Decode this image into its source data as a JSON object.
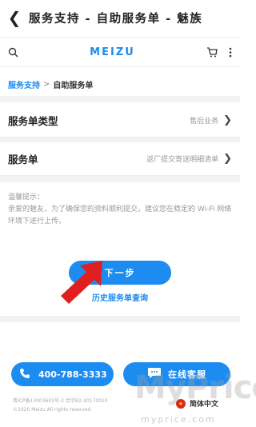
{
  "titlebar": {
    "title": "服务支持 - 自助服务单 - 魅族"
  },
  "navbar": {
    "logo": "MEIZU"
  },
  "breadcrumb": {
    "parent": "服务支持",
    "separator": ">",
    "current": "自助服务单"
  },
  "form": {
    "rows": [
      {
        "label": "服务单类型",
        "value": "售后业务"
      },
      {
        "label": "服务单",
        "value": "返厂提交寄送明细清单"
      }
    ]
  },
  "notice": {
    "line1": "温馨提示：",
    "line2": "亲爱的魅友，为了确保您的资料顺利提交，建议您在稳定的 Wi-Fi 网络环境下进行上传。"
  },
  "actions": {
    "next_label": "下一步",
    "query_label": "历史服务单查询"
  },
  "footer": {
    "phone": "400-788-3333",
    "service_label": "在线客服",
    "icp": "粤ICP备13003602号-2 合字B2-20170010",
    "copyright": "©2020 Meizu All rights reserved",
    "lang": "简体中文"
  },
  "watermark": {
    "main": "MyPrice",
    "sub": "myprice.com"
  },
  "colors": {
    "accent": "#1d8cf0",
    "highlight": "#e02020"
  }
}
